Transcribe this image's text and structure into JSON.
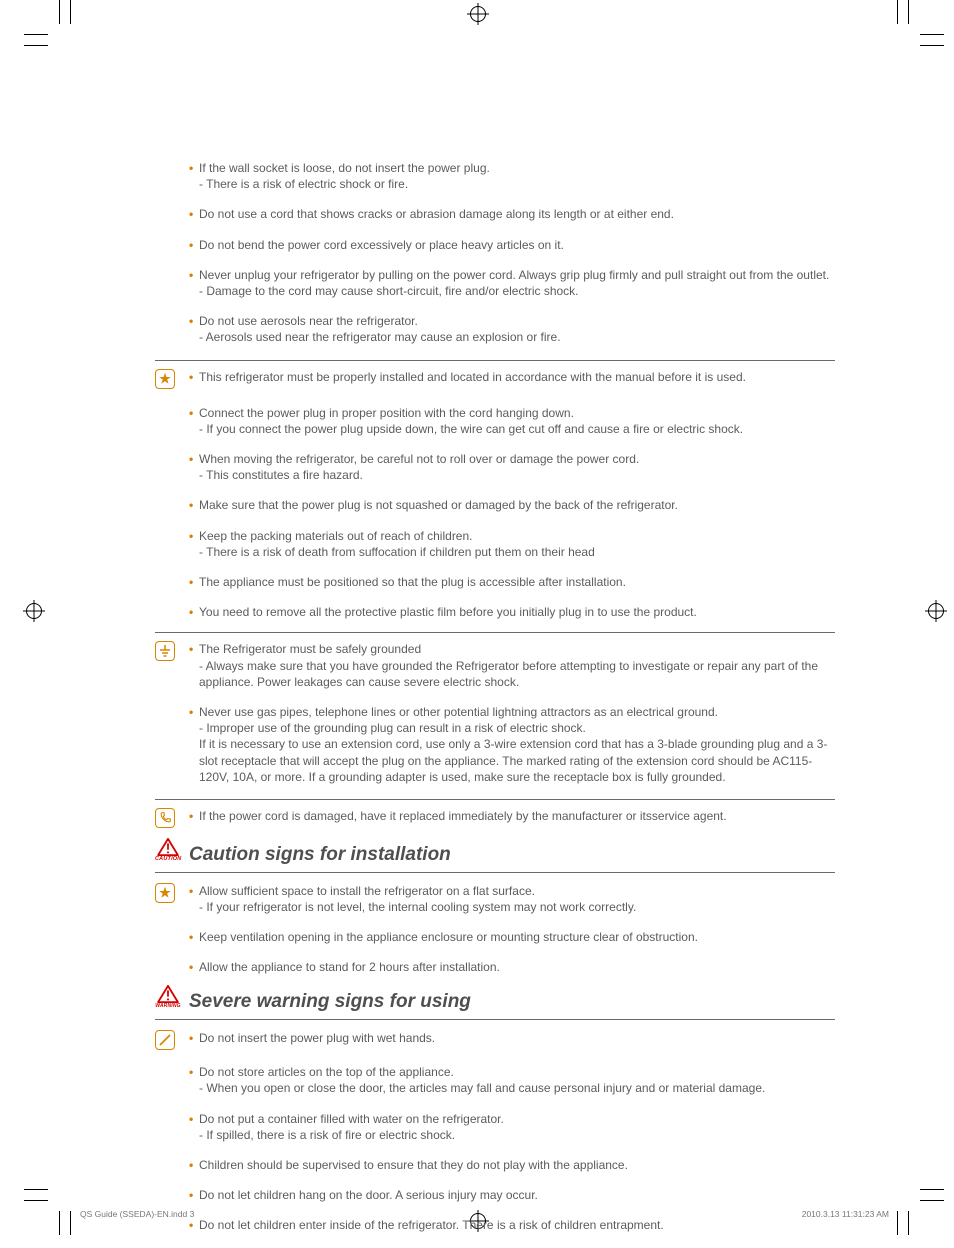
{
  "footer": {
    "left": "QS Guide (SSEDA)-EN.indd   3",
    "right": "2010.3.13   11:31:23 AM"
  },
  "section_caution_title": "Caution signs for installation",
  "section_warning_title": "Severe warning signs for using",
  "caution_label": "CAUTION",
  "warning_label": "WARNING",
  "g1": [
    {
      "t": "If the wall socket is loose, do not insert the power plug.",
      "s": [
        "There is a risk of electric shock or fire."
      ]
    },
    {
      "t": "Do not use a cord that shows cracks or abrasion damage along its length or at either end."
    },
    {
      "t": "Do not bend the power cord excessively or place heavy articles on it."
    },
    {
      "t": "Never unplug your refrigerator by pulling on the power cord. Always grip plug firmly and pull straight out from the outlet.",
      "s": [
        "Damage to the cord may cause short-circuit, fire and/or electric shock."
      ]
    },
    {
      "t": "Do not use aerosols near the refrigerator.",
      "s": [
        "Aerosols used near the refrigerator may cause an explosion or fire."
      ]
    }
  ],
  "g2": [
    {
      "t": "This refrigerator must be properly installed and located in accordance with the manual before it is used."
    },
    {
      "t": "Connect the power plug in proper position with the cord hanging down.",
      "s": [
        "If you connect the power plug upside down, the wire can get cut off and cause a fire or electric shock."
      ]
    },
    {
      "t": "When moving the refrigerator, be careful not to roll over or damage the power cord.",
      "s": [
        "This constitutes a fire hazard."
      ]
    },
    {
      "t": "Make sure that the power plug is not squashed or damaged by the back of the refrigerator."
    },
    {
      "t": "Keep the packing materials out of reach of children.",
      "s": [
        "There is a risk of death from suffocation if children put them on their head"
      ]
    },
    {
      "t": "The appliance must be positioned so that the plug is accessible after installation."
    },
    {
      "t": "You need to remove all the protective plastic film before you initially plug in to use the product."
    }
  ],
  "g3": [
    {
      "t": "The Refrigerator must be safely grounded",
      "s": [
        "Always make sure that you have grounded the Refrigerator before attempting to investigate or repair any part of the appliance. Power leakages can cause severe electric shock."
      ]
    },
    {
      "t": "Never use gas pipes, telephone lines or other potential lightning attractors as an electrical ground.",
      "s": [
        "Improper use of the grounding plug can result in a risk of electric shock."
      ],
      "p": [
        "If it is necessary to use an extension cord, use only a 3-wire extension cord that has a 3-blade grounding plug and a 3-slot receptacle that will accept the plug on the appliance. The marked rating of the extension cord should be AC115-120V, 10A, or more. If a grounding adapter is used, make sure the receptacle box is fully grounded."
      ]
    }
  ],
  "g4": [
    {
      "t": "If the power cord is damaged, have it replaced immediately by the manufacturer or itsservice agent."
    }
  ],
  "g5": [
    {
      "t": "Allow sufficient space to install the refrigerator on a flat surface.",
      "s": [
        "If your refrigerator is not level, the internal cooling system may not work correctly."
      ]
    },
    {
      "t": "Keep ventilation opening in the appliance enclosure or mounting structure clear of obstruction."
    },
    {
      "t": "Allow the appliance to stand for 2 hours after installation."
    }
  ],
  "g6": [
    {
      "t": "Do not insert the power plug with wet hands."
    },
    {
      "t": "Do not store articles on the top of the appliance.",
      "s": [
        "When you open or close the door, the articles may fall and cause personal injury and or material damage."
      ]
    },
    {
      "t": "Do not put a container filled with water on the refrigerator.",
      "s": [
        "If spilled, there is a risk of fire or electric shock."
      ]
    },
    {
      "t": "Children should be supervised to ensure that they do not play with the appliance."
    },
    {
      "t": "Do not let children hang on the door. A serious injury may occur."
    },
    {
      "t": "Do not let children enter inside of the refrigerator. There is a risk of children entrapment."
    }
  ]
}
